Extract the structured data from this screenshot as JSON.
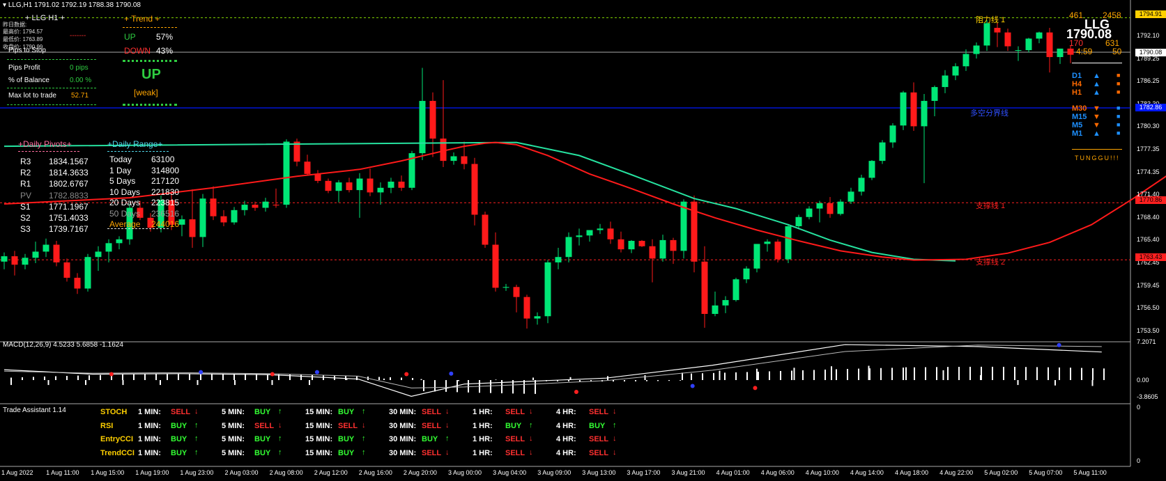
{
  "header": {
    "symbol_line": "LLG,H1  1791.02 1792.19 1788.38 1790.08"
  },
  "top_left_info": {
    "title": "LLG  H1",
    "lines": [
      "昨日数据:",
      "最高价: 1794.57",
      "最低价: 1763.89",
      "收盘价: 1790.99"
    ],
    "pips_to_stop_label": "Pips to Stop",
    "pips_to_stop_value": "-------",
    "pips_profit_label": "Pips Profit",
    "pips_profit_value": "0 pips",
    "pct_balance_label": "% of Balance",
    "pct_balance_value": "0.00 %",
    "max_lot_label": "Max lot to trade",
    "max_lot_value": "52.71"
  },
  "trend_panel": {
    "title": "Trend",
    "up_label": "UP",
    "up_value": "57%",
    "down_label": "DOWN",
    "down_value": "43%",
    "direction": "UP",
    "strength": "[weak]"
  },
  "daily_pivots": {
    "title": "+Daily Pivots+",
    "rows": [
      {
        "label": "R3",
        "value": "1834.1567"
      },
      {
        "label": "R2",
        "value": "1814.3633"
      },
      {
        "label": "R1",
        "value": "1802.6767"
      },
      {
        "label": "PV",
        "value": "1782.8833"
      },
      {
        "label": "S1",
        "value": "1771.1967"
      },
      {
        "label": "S2",
        "value": "1751.4033"
      },
      {
        "label": "S3",
        "value": "1739.7167"
      }
    ]
  },
  "daily_range": {
    "title": "+Daily Range+",
    "rows": [
      {
        "label": "Today",
        "value": "63100"
      },
      {
        "label": "1 Day",
        "value": "314800"
      },
      {
        "label": "5 Days",
        "value": "217120"
      },
      {
        "label": "10 Days",
        "value": "221830"
      },
      {
        "label": "20 Days",
        "value": "223815"
      },
      {
        "label": "50 Days",
        "value": "236516"
      },
      {
        "label": "Average",
        "value": "244016"
      }
    ]
  },
  "top_right": {
    "num1": "461",
    "num2": "2458",
    "name": "LLG",
    "price": "1790.08",
    "num3": "170",
    "num4": "631",
    "timer": "4:59",
    "num5": "50",
    "timeframes": [
      {
        "label": "D1",
        "dir": "up",
        "color": "#1e90ff"
      },
      {
        "label": "H4",
        "dir": "up",
        "color": "#ff6a00"
      },
      {
        "label": "H1",
        "dir": "up",
        "color": "#ff6a00"
      },
      {
        "label": "M30",
        "dir": "down",
        "color": "#ff6a00"
      },
      {
        "label": "M15",
        "dir": "down",
        "color": "#1e90ff"
      },
      {
        "label": "M5",
        "dir": "down",
        "color": "#1e90ff"
      },
      {
        "label": "M1",
        "dir": "up",
        "color": "#1e90ff"
      }
    ],
    "brand": "TUNGGU!!!"
  },
  "line_labels": {
    "resistance1": "阻力线 1",
    "divider": "多空分界线",
    "support1": "支撑线 1",
    "support2": "支撑线 2"
  },
  "price_axis": {
    "ticks": [
      "1792.10",
      "1789.25",
      "1786.25",
      "1783.30",
      "1780.30",
      "1777.35",
      "1774.35",
      "1771.40",
      "1768.40",
      "1765.40",
      "1762.45",
      "1759.45",
      "1756.50",
      "1753.50"
    ],
    "box_resistance": "1794.91",
    "box_current": "1790.08",
    "box_divider": "1782.86",
    "box_support1": "1770.86",
    "box_support2": "1763.43"
  },
  "macd": {
    "label": "MACD(12,26,9) 4.5233 5.6858 -1.1624",
    "ticks": [
      "7.2071",
      "0.00",
      "-3.8605"
    ]
  },
  "trade_assistant": {
    "title": "Trade Assistant 1.14",
    "axis_ticks": [
      "0",
      "0"
    ],
    "timeframes": [
      "1 MIN:",
      "5 MIN:",
      "15 MIN:",
      "30 MIN:",
      "1 HR:",
      "4 HR:"
    ],
    "rows": [
      {
        "name": "STOCH",
        "signals": [
          "SELL",
          "BUY",
          "BUY",
          "SELL",
          "SELL",
          "SELL"
        ]
      },
      {
        "name": "RSI",
        "signals": [
          "BUY",
          "SELL",
          "SELL",
          "SELL",
          "BUY",
          "BUY"
        ]
      },
      {
        "name": "EntryCCI",
        "signals": [
          "BUY",
          "BUY",
          "BUY",
          "BUY",
          "SELL",
          "SELL"
        ]
      },
      {
        "name": "TrendCCI",
        "signals": [
          "BUY",
          "BUY",
          "BUY",
          "SELL",
          "SELL",
          "SELL"
        ]
      }
    ]
  },
  "time_axis": [
    "1 Aug 2022",
    "1 Aug 11:00",
    "1 Aug 15:00",
    "1 Aug 19:00",
    "1 Aug 23:00",
    "2 Aug 03:00",
    "2 Aug 08:00",
    "2 Aug 12:00",
    "2 Aug 16:00",
    "2 Aug 20:00",
    "3 Aug 00:00",
    "3 Aug 04:00",
    "3 Aug 09:00",
    "3 Aug 13:00",
    "3 Aug 17:00",
    "3 Aug 21:00",
    "4 Aug 01:00",
    "4 Aug 06:00",
    "4 Aug 10:00",
    "4 Aug 14:00",
    "4 Aug 18:00",
    "4 Aug 22:00",
    "5 Aug 02:00",
    "5 Aug 07:00",
    "5 Aug 11:00"
  ],
  "colors": {
    "bull": "#00e676",
    "bear": "#ff1a1a",
    "ma_fast": "#ff1a1a",
    "ma_slow": "#26e3a0",
    "buy": "#33ff33",
    "sell": "#ff3030"
  },
  "chart_data": {
    "type": "candlestick",
    "title": "LLG,H1",
    "ylim": [
      1753.5,
      1795.5
    ],
    "ohlc": [
      [
        1763.2,
        1764.4,
        1762.2,
        1763.9
      ],
      [
        1763.9,
        1764.6,
        1761.4,
        1762.8
      ],
      [
        1762.8,
        1764.2,
        1762.2,
        1763.7
      ],
      [
        1763.7,
        1765.8,
        1763.0,
        1764.5
      ],
      [
        1764.5,
        1766.2,
        1763.8,
        1765.4
      ],
      [
        1765.4,
        1765.9,
        1762.6,
        1763.1
      ],
      [
        1763.1,
        1763.6,
        1760.6,
        1761.1
      ],
      [
        1761.1,
        1761.7,
        1759.0,
        1759.7
      ],
      [
        1759.7,
        1764.2,
        1759.3,
        1763.8
      ],
      [
        1763.8,
        1765.2,
        1762.0,
        1764.5
      ],
      [
        1764.5,
        1766.1,
        1763.1,
        1765.6
      ],
      [
        1765.6,
        1766.5,
        1764.8,
        1766.1
      ],
      [
        1766.1,
        1770.7,
        1765.4,
        1770.2
      ],
      [
        1770.2,
        1771.1,
        1768.6,
        1768.9
      ],
      [
        1768.9,
        1769.5,
        1767.1,
        1767.6
      ],
      [
        1767.6,
        1771.8,
        1767.0,
        1771.2
      ],
      [
        1771.2,
        1772.4,
        1767.3,
        1768.0
      ],
      [
        1768.0,
        1769.2,
        1766.5,
        1768.7
      ],
      [
        1768.7,
        1772.6,
        1765.0,
        1766.4
      ],
      [
        1766.4,
        1772.0,
        1765.1,
        1771.4
      ],
      [
        1771.4,
        1773.0,
        1768.6,
        1769.1
      ],
      [
        1769.1,
        1769.9,
        1767.8,
        1768.3
      ],
      [
        1768.3,
        1770.3,
        1768.0,
        1769.9
      ],
      [
        1769.9,
        1771.1,
        1769.2,
        1770.6
      ],
      [
        1770.6,
        1771.0,
        1769.8,
        1770.2
      ],
      [
        1770.2,
        1771.5,
        1769.7,
        1771.0
      ],
      [
        1770.6,
        1772.7,
        1770.2,
        1770.5
      ],
      [
        1770.6,
        1779.1,
        1770.2,
        1778.8
      ],
      [
        1778.8,
        1779.2,
        1775.6,
        1776.2
      ],
      [
        1776.2,
        1777.1,
        1774.4,
        1774.6
      ],
      [
        1774.6,
        1775.1,
        1773.4,
        1773.7
      ],
      [
        1773.7,
        1774.0,
        1772.1,
        1772.4
      ],
      [
        1772.4,
        1773.8,
        1770.9,
        1773.5
      ],
      [
        1773.5,
        1774.1,
        1772.2,
        1772.5
      ],
      [
        1772.5,
        1774.7,
        1768.9,
        1774.0
      ],
      [
        1774.0,
        1775.3,
        1771.7,
        1772.2
      ],
      [
        1772.2,
        1773.5,
        1770.6,
        1772.8
      ],
      [
        1772.8,
        1774.1,
        1772.1,
        1773.6
      ],
      [
        1773.6,
        1774.4,
        1772.4,
        1772.8
      ],
      [
        1772.8,
        1777.6,
        1772.5,
        1777.3
      ],
      [
        1777.3,
        1788.4,
        1776.4,
        1784.1
      ],
      [
        1784.1,
        1785.2,
        1776.8,
        1779.2
      ],
      [
        1779.2,
        1786.8,
        1775.5,
        1776.3
      ],
      [
        1776.3,
        1777.4,
        1775.8,
        1776.9
      ],
      [
        1776.9,
        1778.8,
        1775.2,
        1775.9
      ],
      [
        1775.9,
        1776.7,
        1767.9,
        1769.3
      ],
      [
        1769.3,
        1769.7,
        1765.0,
        1765.4
      ],
      [
        1765.4,
        1767.0,
        1759.3,
        1759.8
      ],
      [
        1759.8,
        1760.3,
        1759.4,
        1759.9
      ],
      [
        1759.9,
        1760.2,
        1756.6,
        1758.6
      ],
      [
        1758.6,
        1758.9,
        1754.5,
        1755.8
      ],
      [
        1755.8,
        1756.6,
        1755.0,
        1756.1
      ],
      [
        1756.1,
        1763.4,
        1755.2,
        1763.1
      ],
      [
        1763.1,
        1765.0,
        1762.2,
        1763.8
      ],
      [
        1763.8,
        1767.0,
        1763.1,
        1766.4
      ],
      [
        1766.4,
        1767.5,
        1765.3,
        1766.6
      ],
      [
        1766.6,
        1767.2,
        1765.8,
        1767.3
      ],
      [
        1767.3,
        1768.1,
        1766.8,
        1767.5
      ],
      [
        1767.5,
        1768.4,
        1765.5,
        1766.1
      ],
      [
        1766.1,
        1767.1,
        1764.4,
        1764.8
      ],
      [
        1764.8,
        1766.0,
        1764.3,
        1765.9
      ],
      [
        1765.9,
        1766.0,
        1765.1,
        1765.2
      ],
      [
        1765.2,
        1766.1,
        1760.5,
        1763.6
      ],
      [
        1763.6,
        1766.7,
        1763.2,
        1766.0
      ],
      [
        1766.0,
        1766.3,
        1762.9,
        1764.6
      ],
      [
        1764.6,
        1771.3,
        1763.6,
        1771.0
      ],
      [
        1771.0,
        1771.8,
        1761.8,
        1763.2
      ],
      [
        1763.2,
        1765.2,
        1754.6,
        1756.4
      ],
      [
        1756.4,
        1759.3,
        1756.1,
        1757.5
      ],
      [
        1757.5,
        1758.7,
        1756.5,
        1758.2
      ],
      [
        1758.2,
        1761.1,
        1758.0,
        1760.9
      ],
      [
        1760.9,
        1762.6,
        1760.4,
        1762.3
      ],
      [
        1762.3,
        1764.9,
        1761.8,
        1765.5
      ],
      [
        1765.5,
        1766.1,
        1764.5,
        1765.8
      ],
      [
        1765.8,
        1766.1,
        1763.1,
        1763.5
      ],
      [
        1763.5,
        1768.1,
        1763.0,
        1767.8
      ],
      [
        1767.8,
        1769.3,
        1767.4,
        1769.0
      ],
      [
        1769.0,
        1770.4,
        1768.7,
        1770.1
      ],
      [
        1770.1,
        1771.1,
        1768.3,
        1770.8
      ],
      [
        1770.8,
        1771.6,
        1768.9,
        1769.4
      ],
      [
        1769.4,
        1771.3,
        1769.2,
        1771.0
      ],
      [
        1771.0,
        1772.8,
        1770.7,
        1772.3
      ],
      [
        1772.3,
        1774.5,
        1771.8,
        1774.1
      ],
      [
        1774.1,
        1776.4,
        1773.8,
        1776.3
      ],
      [
        1776.3,
        1779.0,
        1775.9,
        1778.7
      ],
      [
        1778.7,
        1781.2,
        1778.0,
        1780.9
      ],
      [
        1780.9,
        1785.4,
        1780.3,
        1785.2
      ],
      [
        1785.2,
        1786.5,
        1780.2,
        1780.8
      ],
      [
        1780.8,
        1785.0,
        1773.4,
        1784.1
      ],
      [
        1784.1,
        1786.1,
        1782.1,
        1785.9
      ],
      [
        1785.9,
        1788.1,
        1785.1,
        1787.4
      ],
      [
        1787.4,
        1789.0,
        1786.8,
        1788.6
      ],
      [
        1788.6,
        1790.8,
        1788.0,
        1790.2
      ],
      [
        1790.2,
        1791.7,
        1789.6,
        1791.3
      ],
      [
        1791.3,
        1794.6,
        1790.6,
        1794.2
      ],
      [
        1793.6,
        1794.3,
        1791.1,
        1793.0
      ],
      [
        1793.0,
        1793.5,
        1790.6,
        1791.2
      ],
      [
        1790.7,
        1791.2,
        1789.3,
        1790.7
      ],
      [
        1790.7,
        1792.3,
        1790.4,
        1792.2
      ],
      [
        1792.2,
        1793.1,
        1791.6,
        1793.0
      ],
      [
        1793.0,
        1793.6,
        1787.8,
        1789.8
      ],
      [
        1789.8,
        1790.7,
        1788.9,
        1790.9
      ],
      [
        1790.9,
        1791.3,
        1789.0,
        1790.1
      ]
    ],
    "levels": {
      "resistance_1": 1794.91,
      "divider": 1782.86,
      "support_1": 1770.86,
      "support_2": 1763.43
    },
    "ma_fast": [
      [
        0,
        1770.7
      ],
      [
        12,
        1771.5
      ],
      [
        20,
        1772.8
      ],
      [
        28,
        1774.3
      ],
      [
        34,
        1775.2
      ],
      [
        38,
        1776.3
      ],
      [
        42,
        1777.6
      ],
      [
        44,
        1778.2
      ],
      [
        46,
        1778.6
      ],
      [
        47,
        1778.7
      ],
      [
        49,
        1778.4
      ],
      [
        52,
        1777.0
      ],
      [
        56,
        1774.6
      ],
      [
        60,
        1772.7
      ],
      [
        64,
        1770.7
      ],
      [
        68,
        1768.9
      ],
      [
        72,
        1767.3
      ],
      [
        76,
        1765.9
      ],
      [
        80,
        1764.6
      ],
      [
        84,
        1763.8
      ],
      [
        87,
        1763.4
      ],
      [
        92,
        1763.5
      ],
      [
        96,
        1764.3
      ],
      [
        100,
        1765.7
      ],
      [
        104,
        1768.0
      ],
      [
        108,
        1771.4
      ],
      [
        112,
        1775.1
      ],
      [
        116,
        1778.8
      ],
      [
        120,
        1782.0
      ],
      [
        124,
        1784.7
      ],
      [
        128,
        1787.5
      ],
      [
        130,
        1789.0
      ]
    ],
    "ma_slow": [
      [
        0,
        1778.2
      ],
      [
        49,
        1778.7
      ],
      [
        55,
        1777.0
      ],
      [
        60,
        1774.5
      ],
      [
        66,
        1771.4
      ],
      [
        70,
        1770.1
      ],
      [
        75,
        1768.0
      ],
      [
        79,
        1766.0
      ],
      [
        83,
        1764.4
      ],
      [
        87,
        1763.5
      ],
      [
        91,
        1763.3
      ]
    ],
    "macd_main": [
      [
        0,
        3.0
      ],
      [
        20,
        2.6
      ],
      [
        40,
        3.0
      ],
      [
        60,
        -2.0
      ],
      [
        80,
        1.0
      ],
      [
        100,
        6.5
      ],
      [
        120,
        7.0
      ],
      [
        130,
        4.5
      ]
    ],
    "macd_hist_sample": [
      -1.0,
      -1.0,
      -1.0,
      -1.0,
      -1.0,
      -1.0,
      -1.0,
      -1.0,
      -1.0,
      0.2,
      0.3,
      0.2,
      -0.2,
      0.1,
      0.5,
      0.6,
      0.8,
      1.0,
      1.5,
      1.9,
      2.3,
      2.5,
      2.8,
      2.9,
      2.6,
      2.0,
      1.0,
      -1.0,
      -1.1,
      -1.2
    ]
  }
}
